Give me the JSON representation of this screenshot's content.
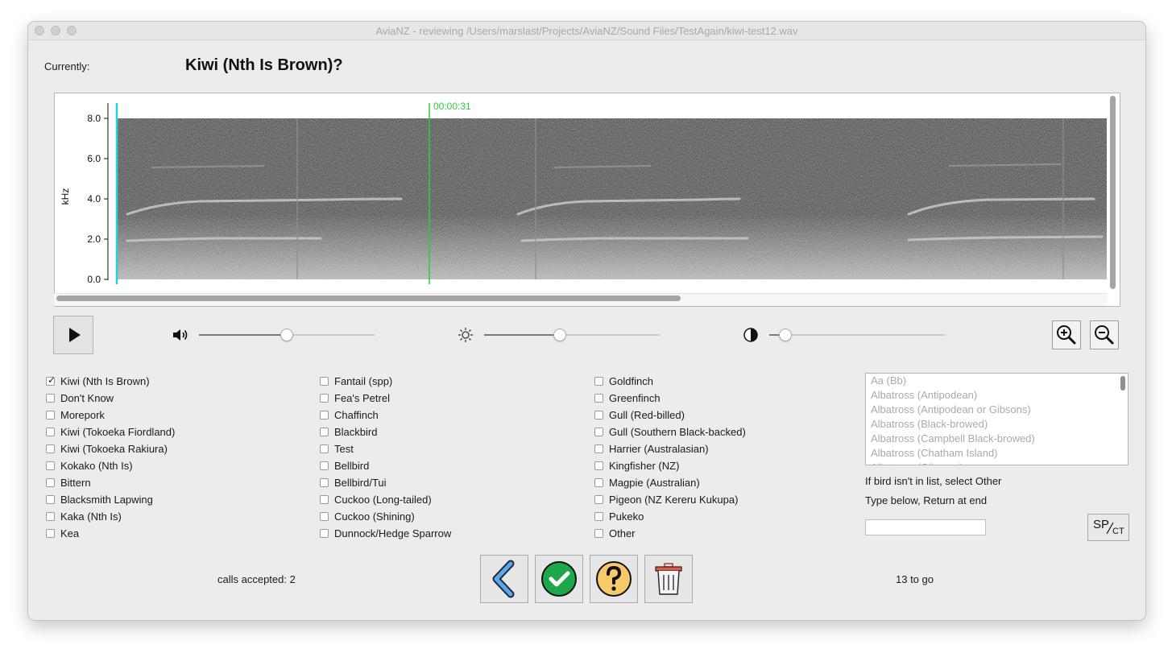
{
  "window": {
    "title": "AviaNZ - reviewing /Users/marslast/Projects/AviaNZ/Sound Files/TestAgain/kiwi-test12.wav"
  },
  "header": {
    "currently_label": "Currently:",
    "current_bird": "Kiwi (Nth Is Brown)?"
  },
  "spectrogram": {
    "y_axis_label": "kHz",
    "y_ticks": [
      "8.0",
      "6.0",
      "4.0",
      "2.0",
      "0.0"
    ],
    "time_marker_label": "00:00:31",
    "marker_colors": {
      "start": "#22d3d8",
      "time": "#2ecc40"
    }
  },
  "controls": {
    "volume": {
      "icon": "speaker-icon",
      "level": 0.5
    },
    "brightness": {
      "icon": "sun-icon",
      "level": 0.43
    },
    "contrast": {
      "icon": "contrast-icon",
      "level": 0.09
    }
  },
  "birds": {
    "columns": [
      [
        {
          "label": "Kiwi (Nth Is Brown)",
          "checked": true
        },
        {
          "label": "Don't Know",
          "checked": false
        },
        {
          "label": "Morepork",
          "checked": false
        },
        {
          "label": "Kiwi (Tokoeka Fiordland)",
          "checked": false
        },
        {
          "label": "Kiwi (Tokoeka Rakiura)",
          "checked": false
        },
        {
          "label": "Kokako (Nth Is)",
          "checked": false
        },
        {
          "label": "Bittern",
          "checked": false
        },
        {
          "label": "Blacksmith Lapwing",
          "checked": false
        },
        {
          "label": "Kaka (Nth Is)",
          "checked": false
        },
        {
          "label": "Kea",
          "checked": false
        }
      ],
      [
        {
          "label": "Fantail (spp)",
          "checked": false
        },
        {
          "label": "Fea's Petrel",
          "checked": false
        },
        {
          "label": "Chaffinch",
          "checked": false
        },
        {
          "label": "Blackbird",
          "checked": false
        },
        {
          "label": "Test",
          "checked": false
        },
        {
          "label": "Bellbird",
          "checked": false
        },
        {
          "label": "Bellbird/Tui",
          "checked": false
        },
        {
          "label": "Cuckoo (Long-tailed)",
          "checked": false
        },
        {
          "label": "Cuckoo (Shining)",
          "checked": false
        },
        {
          "label": "Dunnock/Hedge Sparrow",
          "checked": false
        }
      ],
      [
        {
          "label": "Goldfinch",
          "checked": false
        },
        {
          "label": "Greenfinch",
          "checked": false
        },
        {
          "label": "Gull (Red-billed)",
          "checked": false
        },
        {
          "label": "Gull (Southern Black-backed)",
          "checked": false
        },
        {
          "label": "Harrier (Australasian)",
          "checked": false
        },
        {
          "label": "Kingfisher (NZ)",
          "checked": false
        },
        {
          "label": "Magpie (Australian)",
          "checked": false
        },
        {
          "label": "Pigeon (NZ Kereru Kukupa)",
          "checked": false
        },
        {
          "label": "Pukeko",
          "checked": false
        },
        {
          "label": "Other",
          "checked": false
        }
      ]
    ]
  },
  "species_list": {
    "items": [
      "Aa (Bb)",
      "Albatross (Antipodean)",
      "Albatross (Antipodean or Gibsons)",
      "Albatross (Black-browed)",
      "Albatross (Campbell Black-browed)",
      "Albatross (Chatham Island)",
      "Albatross (Gibsons)"
    ],
    "hint1": "If bird isn't in list, select Other",
    "hint2": "Type below, Return at end",
    "entry_value": "",
    "spct_main": "SP",
    "spct_sub": "CT"
  },
  "footer": {
    "calls_accepted": "calls accepted: 2",
    "to_go": "13 to go"
  }
}
